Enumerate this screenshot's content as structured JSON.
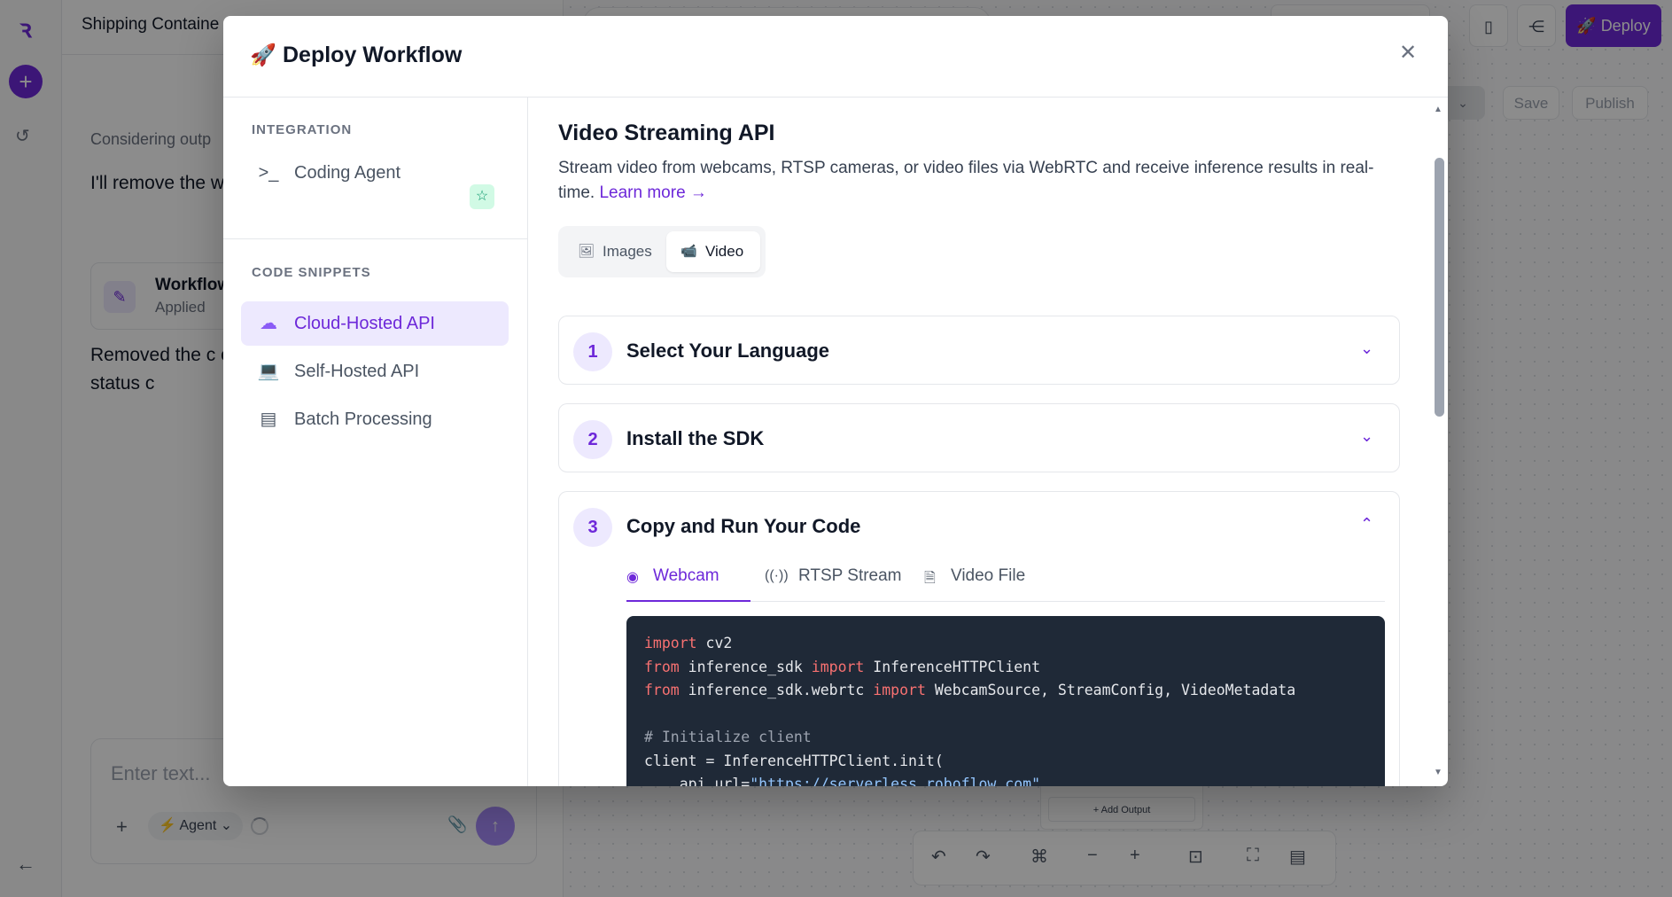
{
  "app": {
    "title": "Shipping Containe",
    "header_buttons": {
      "deploy": "Deploy",
      "save": "Save",
      "publish": "Publish"
    }
  },
  "chat": {
    "considering": "Considering outp",
    "message1": "I'll remove the workflow focus visualization.",
    "card": {
      "title": "Workflow",
      "subtitle": "Applied"
    },
    "message2": "Removed the c output. The wo annotated imag Events status c",
    "composer": {
      "placeholder": "Enter text...",
      "mode": "Agent"
    }
  },
  "canvas": {
    "add_output": "+ Add Output"
  },
  "modal": {
    "title": "Deploy Workflow",
    "sidebar": {
      "integration_label": "INTEGRATION",
      "integration_items": [
        {
          "label": "Coding Agent",
          "icon": "terminal-icon"
        }
      ],
      "snippets_label": "CODE SNIPPETS",
      "snippet_items": [
        {
          "label": "Cloud-Hosted API",
          "icon": "cloud-icon",
          "active": true
        },
        {
          "label": "Self-Hosted API",
          "icon": "laptop-icon",
          "active": false
        },
        {
          "label": "Batch Processing",
          "icon": "batch-icon",
          "active": false
        }
      ]
    },
    "content": {
      "heading": "Video Streaming API",
      "description": "Stream video from webcams, RTSP cameras, or video files via WebRTC and receive inference results in real-time.",
      "learn_more": "Learn more →",
      "mode_options": [
        {
          "label": "Images",
          "icon": "image-icon",
          "active": false
        },
        {
          "label": "Video",
          "icon": "video-icon",
          "active": true
        }
      ],
      "steps": [
        {
          "number": "1",
          "title": "Select Your Language",
          "expanded": false
        },
        {
          "number": "2",
          "title": "Install the SDK",
          "expanded": false
        },
        {
          "number": "3",
          "title": "Copy and Run Your Code",
          "expanded": true
        }
      ],
      "source_tabs": [
        {
          "label": "Webcam",
          "icon": "webcam-icon",
          "active": true
        },
        {
          "label": "RTSP Stream",
          "icon": "broadcast-icon",
          "active": false
        },
        {
          "label": "Video File",
          "icon": "file-icon",
          "active": false
        }
      ],
      "code": {
        "line1_kw": "import",
        "line1_rest": " cv2",
        "line2_kw1": "from",
        "line2_mod": " inference_sdk ",
        "line2_kw2": "import",
        "line2_rest": " InferenceHTTPClient",
        "line3_kw1": "from",
        "line3_mod": " inference_sdk.webrtc ",
        "line3_kw2": "import",
        "line3_rest": " WebcamSource, StreamConfig, VideoMetadata",
        "line5_comment": "# Initialize client",
        "line6": "client = InferenceHTTPClient.init(",
        "line7_pre": "    api_url=",
        "line7_str": "\"https://serverless.roboflow.com\"",
        "line7_post": ","
      }
    }
  },
  "colors": {
    "accent": "#6d28d9",
    "accent_soft": "#ede9fe",
    "code_bg": "#1f2937"
  }
}
